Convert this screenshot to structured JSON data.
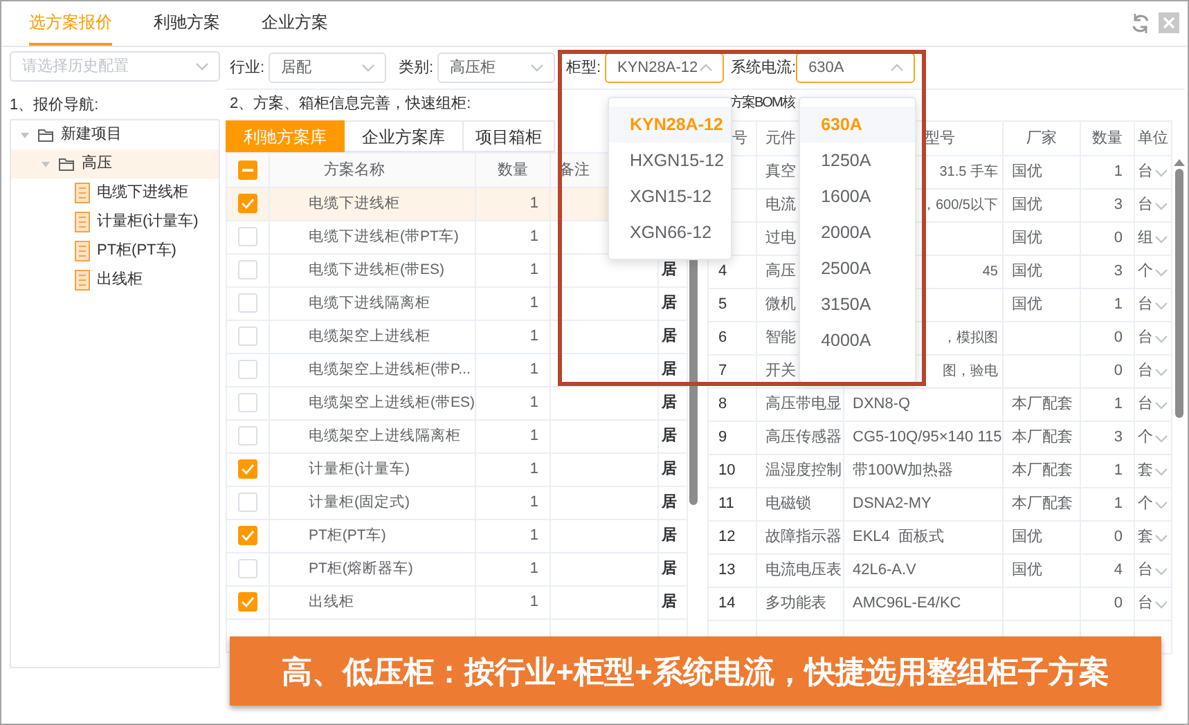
{
  "top_tabs": [
    {
      "label": "选方案报价",
      "selected": true
    },
    {
      "label": "利驰方案",
      "selected": false
    },
    {
      "label": "企业方案",
      "selected": false
    }
  ],
  "history_select": {
    "placeholder": "请选择历史配置"
  },
  "filters": [
    {
      "label": "行业:",
      "value": "居配",
      "open": false
    },
    {
      "label": "类别:",
      "value": "高压柜",
      "open": false
    },
    {
      "label": "柜型:",
      "value": "KYN28A-12",
      "open": true,
      "options": [
        {
          "label": "KYN28A-12",
          "selected": true
        },
        {
          "label": "HXGN15-12",
          "selected": false
        },
        {
          "label": "XGN15-12",
          "selected": false
        },
        {
          "label": "XGN66-12",
          "selected": false
        }
      ]
    },
    {
      "label": "系统电流:",
      "value": "630A",
      "open": true,
      "options": [
        {
          "label": "630A",
          "selected": true
        },
        {
          "label": "1250A",
          "selected": false
        },
        {
          "label": "1600A",
          "selected": false
        },
        {
          "label": "2000A",
          "selected": false
        },
        {
          "label": "2500A",
          "selected": false
        },
        {
          "label": "3150A",
          "selected": false
        },
        {
          "label": "4000A",
          "selected": false
        }
      ]
    }
  ],
  "nav": {
    "title": "1、报价导航:",
    "tree": [
      {
        "label": "新建项目",
        "kind": "folder",
        "expanded": true,
        "selected": false,
        "children": [
          {
            "label": "高压",
            "kind": "folder",
            "expanded": true,
            "selected": true,
            "children": [
              {
                "label": "电缆下进线柜",
                "kind": "cabinet",
                "selected": false
              },
              {
                "label": "计量柜(计量车)",
                "kind": "cabinet",
                "selected": false
              },
              {
                "label": "PT柜(PT车)",
                "kind": "cabinet",
                "selected": false
              },
              {
                "label": "出线柜",
                "kind": "cabinet",
                "selected": false
              }
            ]
          }
        ]
      }
    ]
  },
  "scheme": {
    "title": "2、方案、箱柜信息完善，快速组柜:",
    "tabs": [
      {
        "label": "利驰方案库",
        "selected": true
      },
      {
        "label": "企业方案库",
        "selected": false
      },
      {
        "label": "项目箱柜",
        "selected": false
      }
    ],
    "select_all": {
      "indeterminate": true
    },
    "columns": [
      "方案名称",
      "数量",
      "备注"
    ],
    "rows": [
      {
        "name": "电缆下进线柜",
        "quantity": "1",
        "checked": true,
        "selected": true
      },
      {
        "name": "电缆下进线柜(带PT车)",
        "quantity": "1",
        "checked": false,
        "selected": false
      },
      {
        "name": "电缆下进线柜(带ES)",
        "quantity": "1",
        "column_4": "居",
        "checked": false,
        "selected": false
      },
      {
        "name": "电缆下进线隔离柜",
        "quantity": "1",
        "column_4": "居",
        "checked": false,
        "selected": false
      },
      {
        "name": "电缆架空上进线柜",
        "quantity": "1",
        "column_4": "居",
        "checked": false,
        "selected": false
      },
      {
        "name": "电缆架空上进线柜(带P...",
        "quantity": "1",
        "column_4": "居",
        "checked": false,
        "selected": false
      },
      {
        "name": "电缆架空上进线柜(带ES)",
        "quantity": "1",
        "column_4": "居",
        "checked": false,
        "selected": false
      },
      {
        "name": "电缆架空上进线隔离柜",
        "quantity": "1",
        "column_4": "居",
        "checked": false,
        "selected": false
      },
      {
        "name": "计量柜(计量车)",
        "quantity": "1",
        "column_4": "居",
        "checked": true,
        "selected": false
      },
      {
        "name": "计量柜(固定式)",
        "quantity": "1",
        "column_4": "居",
        "checked": false,
        "selected": false
      },
      {
        "name": "PT柜(PT车)",
        "quantity": "1",
        "column_4": "居",
        "checked": true,
        "selected": false
      },
      {
        "name": "PT柜(熔断器车)",
        "quantity": "1",
        "column_4": "居",
        "checked": false,
        "selected": false
      },
      {
        "name": "出线柜",
        "quantity": "1",
        "column_4": "居",
        "checked": true,
        "selected": false
      }
    ]
  },
  "bom": {
    "title": "方案BOM核",
    "columns": [
      "号",
      "元件",
      "型号",
      "厂家",
      "数量",
      "单位"
    ],
    "rows": [
      {
        "component": "真空",
        "model": "31.5 手车",
        "maker": "国优",
        "quantity": "1",
        "unit": "台"
      },
      {
        "component": "电流",
        "model": "，600/5以下",
        "maker": "国优",
        "quantity": "3",
        "unit": "台"
      },
      {
        "component": "过电",
        "maker": "国优",
        "quantity": "0",
        "unit": "组"
      },
      {
        "no": "4",
        "component": "高压",
        "model": "45",
        "maker": "国优",
        "quantity": "3",
        "unit": "个"
      },
      {
        "no": "5",
        "component": "微机",
        "maker": "国优",
        "quantity": "1",
        "unit": "台"
      },
      {
        "no": "6",
        "component": "智能",
        "model": "，模拟图",
        "quantity": "0",
        "unit": "台"
      },
      {
        "no": "7",
        "component": "开关",
        "model": "图，验电",
        "quantity": "0",
        "unit": "台"
      },
      {
        "no": "8",
        "component": "高压带电显",
        "model": "DXN8-Q",
        "maker": "本厂配套",
        "quantity": "1",
        "unit": "台"
      },
      {
        "no": "9",
        "component": "高压传感器",
        "model": "CG5-10Q/95×140 115",
        "maker": "本厂配套",
        "quantity": "3",
        "unit": "个"
      },
      {
        "no": "10",
        "component": "温湿度控制",
        "model": "带100W加热器",
        "maker": "本厂配套",
        "quantity": "1",
        "unit": "套"
      },
      {
        "no": "11",
        "component": "电磁锁",
        "model": "DSNA2-MY",
        "maker": "本厂配套",
        "quantity": "1",
        "unit": "个"
      },
      {
        "no": "12",
        "component": "故障指示器",
        "model": "EKL4  面板式",
        "maker": "国优",
        "quantity": "0",
        "unit": "套"
      },
      {
        "no": "13",
        "component": "电流电压表",
        "model": "42L6-A.V",
        "maker": "国优",
        "quantity": "4",
        "unit": "台"
      },
      {
        "no": "14",
        "component": "多功能表",
        "model": "AMC96L-E4/KC",
        "quantity": "0",
        "unit": "台"
      }
    ]
  },
  "banner": "高、低压柜：按行业+柜型+系统电流，快捷选用整组柜子方案"
}
